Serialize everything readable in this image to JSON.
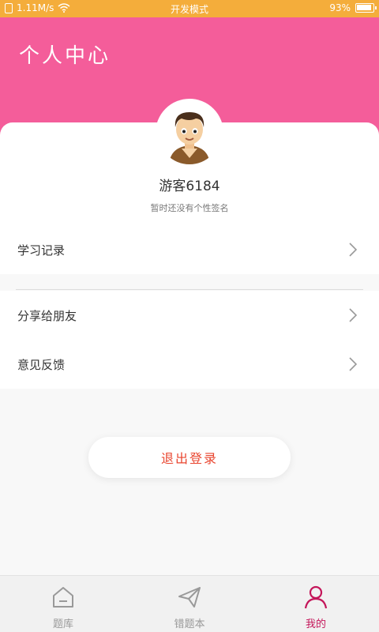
{
  "status_bar": {
    "speed": "1.11M/s",
    "mode": "开发模式",
    "battery": "93%",
    "battery_level": 0.93
  },
  "header": {
    "title": "个人中心"
  },
  "profile": {
    "username": "游客6184",
    "signature": "暂时还没有个性签名"
  },
  "menu": {
    "study_record": "学习记录",
    "share": "分享给朋友",
    "feedback": "意见反馈"
  },
  "logout_label": "退出登录",
  "tabs": [
    {
      "label": "题库",
      "icon": "home-icon"
    },
    {
      "label": "错题本",
      "icon": "paper-plane-icon"
    },
    {
      "label": "我的",
      "icon": "user-icon"
    }
  ],
  "colors": {
    "header": "#f45d9a",
    "status_bar": "#f4ad3b",
    "logout_text": "#e9452f",
    "active_tab": "#c4165a"
  }
}
